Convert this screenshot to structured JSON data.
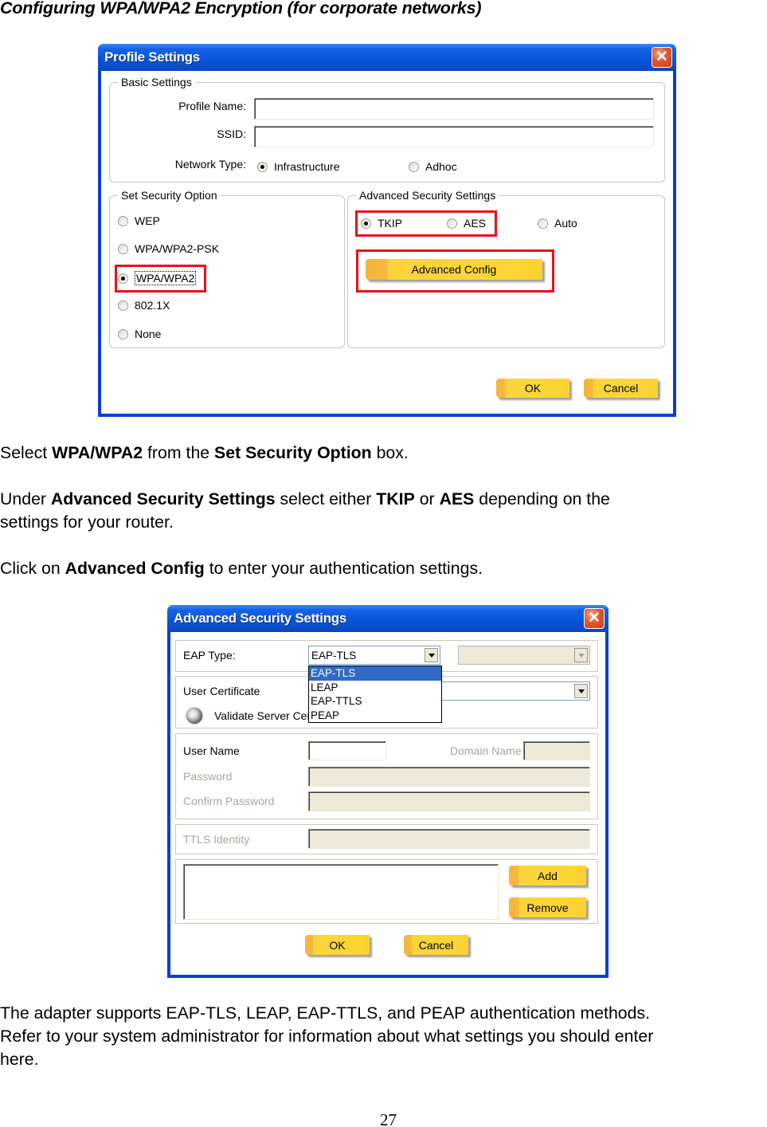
{
  "document": {
    "heading": "Configuring WPA/WPA2 Encryption (for corporate networks)",
    "para1": {
      "t1": "Select ",
      "b1": "WPA/WPA2",
      "t2": " from the ",
      "b2": "Set Security Option",
      "t3": " box."
    },
    "para2": {
      "t1": "Under ",
      "b1": "Advanced Security Settings",
      "t2": " select either ",
      "b2": "TKIP",
      "t3": " or ",
      "b3": "AES",
      "t4": " depending on the",
      "line2": "settings for your router."
    },
    "para3": {
      "t1": "Click on ",
      "b1": "Advanced Config",
      "t2": " to enter your authentication settings."
    },
    "para4": {
      "line1": "The adapter supports EAP-TLS, LEAP, EAP-TTLS, and PEAP authentication methods.",
      "line2": "Refer to your system administrator for information about what settings you should enter",
      "line3": "here."
    },
    "page_number": "27"
  },
  "profile_dialog": {
    "title": "Profile Settings",
    "close_glyph": "✕",
    "basic_settings": {
      "legend": "Basic Settings",
      "profile_name_label": "Profile Name:",
      "profile_name_value": "",
      "ssid_label": "SSID:",
      "ssid_value": "",
      "network_type_label": "Network Type:",
      "network_types": [
        {
          "label": "Infrastructure",
          "checked": true
        },
        {
          "label": "Adhoc",
          "checked": false
        }
      ]
    },
    "security_option": {
      "legend": "Set Security Option",
      "options": [
        {
          "label": "WEP",
          "checked": false
        },
        {
          "label": "WPA/WPA2-PSK",
          "checked": false
        },
        {
          "label": "WPA/WPA2",
          "checked": true
        },
        {
          "label": "802.1X",
          "checked": false
        },
        {
          "label": "None",
          "checked": false
        }
      ]
    },
    "advanced_security": {
      "legend": "Advanced Security Settings",
      "ciphers": [
        {
          "label": "TKIP",
          "checked": true
        },
        {
          "label": "AES",
          "checked": false
        },
        {
          "label": "Auto",
          "checked": false
        }
      ],
      "advanced_config_label": "Advanced Config"
    },
    "ok_label": "OK",
    "cancel_label": "Cancel",
    "highlight_color": "#e8121a"
  },
  "advanced_dialog": {
    "title": "Advanced Security Settings",
    "close_glyph": "✕",
    "eap_type_label": "EAP Type:",
    "eap_type_value": "EAP-TLS",
    "eap_options": [
      "EAP-TLS",
      "LEAP",
      "EAP-TTLS",
      "PEAP"
    ],
    "eap_selected_option": "EAP-TLS",
    "secondary_select_value": "",
    "user_certificate_label": "User Certificate",
    "validate_server_label": "Validate Server Cer",
    "user_name_label": "User Name",
    "user_name_value": "",
    "domain_name_label": "Domain Name",
    "password_label": "Password",
    "confirm_password_label": "Confirm Password",
    "ttls_identity_label": "TTLS Identity",
    "add_label": "Add",
    "remove_label": "Remove",
    "ok_label": "OK",
    "cancel_label": "Cancel",
    "selection_color": "#316ac5"
  }
}
